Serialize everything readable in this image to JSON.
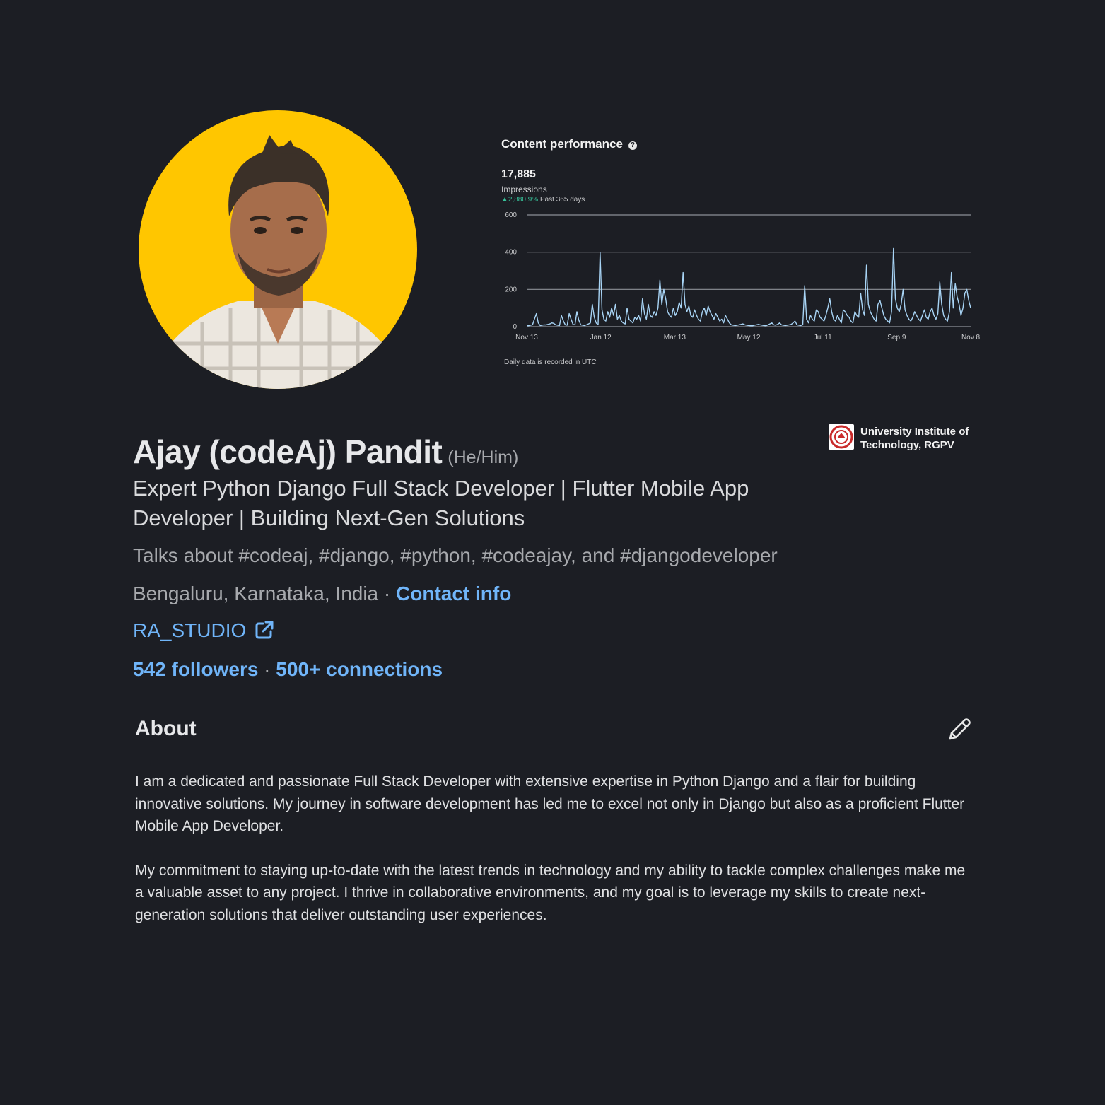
{
  "profile": {
    "name": "Ajay (codeAj) Pandit",
    "pronouns": "(He/Him)",
    "headline": "Expert Python Django Full Stack Developer | Flutter Mobile App Developer | Building Next-Gen Solutions",
    "talks_about": "Talks about #codeaj, #django, #python, #codeajay, and #djangodeveloper",
    "location": "Bengaluru, Karnataka, India",
    "location_sep": " · ",
    "contact_label": "Contact info",
    "company_link": "RA_STUDIO",
    "followers": "542 followers",
    "connections_sep": " · ",
    "connections": "500+ connections",
    "avatar_bg": "#ffc600"
  },
  "education": {
    "school": "University Institute of Technology, RGPV"
  },
  "performance": {
    "title": "Content performance",
    "value": "17,885",
    "metric": "Impressions",
    "change": "▲2,880.9%",
    "period": "Past 365 days",
    "note": "Daily data is recorded in UTC"
  },
  "chart_data": {
    "type": "line",
    "title": "Content performance",
    "ylabel": "Impressions",
    "xlabel": "",
    "ylim": [
      0,
      600
    ],
    "yticks": [
      0,
      200,
      400,
      600
    ],
    "xticks": [
      "Nov 13",
      "Jan 12",
      "Mar 13",
      "May 12",
      "Jul 11",
      "Sep 9",
      "Nov 8"
    ],
    "grid": true,
    "color": "#a8d4f5",
    "series": [
      {
        "values": [
          5,
          5,
          8,
          10,
          40,
          70,
          20,
          6,
          8,
          10,
          9,
          12,
          15,
          20,
          18,
          10,
          8,
          6,
          60,
          30,
          10,
          8,
          70,
          40,
          12,
          10,
          80,
          35,
          10,
          8,
          6,
          10,
          15,
          20,
          120,
          50,
          20,
          10,
          400,
          90,
          40,
          30,
          80,
          50,
          100,
          60,
          120,
          40,
          60,
          30,
          20,
          15,
          100,
          40,
          30,
          20,
          50,
          40,
          60,
          30,
          150,
          70,
          40,
          120,
          60,
          50,
          80,
          60,
          100,
          250,
          120,
          200,
          150,
          80,
          60,
          50,
          100,
          60,
          80,
          130,
          100,
          290,
          120,
          80,
          110,
          60,
          50,
          90,
          60,
          40,
          30,
          80,
          100,
          60,
          110,
          80,
          60,
          40,
          70,
          50,
          30,
          40,
          20,
          60,
          40,
          20,
          10,
          8,
          6,
          8,
          10,
          12,
          15,
          10,
          8,
          6,
          5,
          5,
          8,
          10,
          12,
          10,
          8,
          6,
          5,
          10,
          15,
          20,
          10,
          8,
          12,
          20,
          10,
          8,
          6,
          8,
          10,
          12,
          20,
          30,
          10,
          8,
          6,
          10,
          220,
          40,
          20,
          60,
          40,
          30,
          90,
          80,
          50,
          40,
          30,
          60,
          100,
          150,
          80,
          40,
          30,
          60,
          40,
          20,
          90,
          80,
          60,
          50,
          30,
          20,
          80,
          60,
          50,
          180,
          90,
          60,
          330,
          120,
          80,
          60,
          40,
          30,
          120,
          140,
          100,
          60,
          40,
          30,
          20,
          80,
          420,
          150,
          100,
          80,
          120,
          200,
          90,
          60,
          40,
          30,
          50,
          80,
          60,
          40,
          30,
          60,
          90,
          50,
          40,
          80,
          100,
          60,
          40,
          70,
          240,
          120,
          60,
          40,
          30,
          80,
          290,
          100,
          230,
          160,
          120,
          60,
          100,
          180,
          200,
          140,
          100
        ]
      }
    ]
  },
  "about": {
    "title": "About",
    "paragraphs": [
      "I am a dedicated and passionate Full Stack Developer with extensive expertise in Python Django and a flair for building innovative solutions. My journey in software development has led me to excel not only in Django but also as a proficient Flutter Mobile App Developer.",
      "My commitment to staying up-to-date with the latest trends in technology and my ability to tackle complex challenges make me a valuable asset to any project. I thrive in collaborative environments, and my goal is to leverage my skills to create next-generation solutions that deliver outstanding user experiences."
    ]
  },
  "icons": {
    "help": "help-icon",
    "external_link": "external-link-icon",
    "edit": "pencil-icon",
    "school_logo": "school-logo"
  },
  "colors": {
    "background": "#1c1e24",
    "link": "#70b5f9",
    "positive": "#37c39a"
  }
}
